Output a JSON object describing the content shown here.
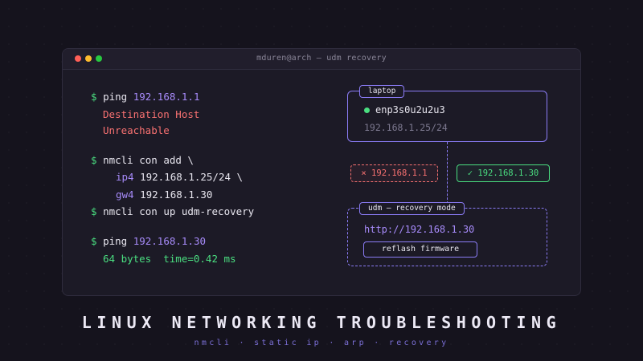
{
  "window": {
    "title": "mduren@arch — udm recovery"
  },
  "terminal": {
    "cmd1": {
      "prompt": "$",
      "command": "ping",
      "arg": "192.168.1.1"
    },
    "error1": "Destination Host",
    "error2": "Unreachable",
    "cmd2": {
      "prompt": "$",
      "text": "nmcli con add \\"
    },
    "cmd2_ip4": {
      "flag": "ip4",
      "value": "192.168.1.25/24 \\"
    },
    "cmd2_gw4": {
      "flag": "gw4",
      "value": "192.168.1.30"
    },
    "cmd3": {
      "prompt": "$",
      "text": "nmcli con up udm-recovery"
    },
    "cmd4": {
      "prompt": "$",
      "command": "ping",
      "arg": "192.168.1.30"
    },
    "reply": "64 bytes  time=0.42 ms"
  },
  "diagram": {
    "laptop": {
      "tag": "laptop",
      "interface": "enp3s0u2u2u3",
      "address": "192.168.1.25/24"
    },
    "bad_route": "× 192.168.1.1",
    "good_route": "✓ 192.168.1.30",
    "udm": {
      "tag": "udm — recovery mode",
      "url": "http://192.168.1.30",
      "button": "reflash firmware"
    }
  },
  "footer": {
    "title": "LINUX NETWORKING TROUBLESHOOTING",
    "subtitle": "nmcli · static ip · arp · recovery"
  },
  "colors": {
    "background": "#15131d",
    "accent": "#8b7cf6",
    "success": "#4ade80",
    "error": "#f87171"
  }
}
